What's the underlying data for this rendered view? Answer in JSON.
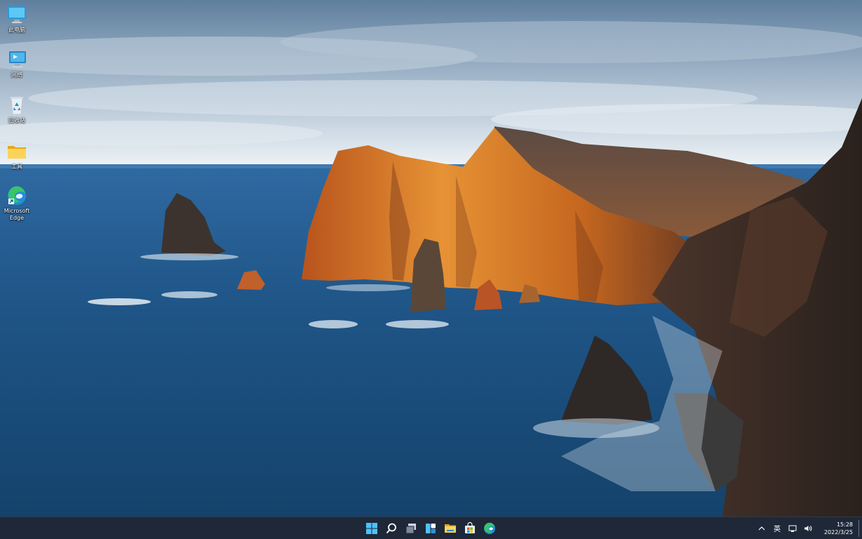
{
  "desktop": {
    "wallpaper": "coastal-cliffs-sea-wallpaper",
    "icons": [
      {
        "label": "此电脑",
        "icon": "this-pc-icon"
      },
      {
        "label": "网络",
        "icon": "network-icon"
      },
      {
        "label": "回收站",
        "icon": "recycle-bin-icon"
      },
      {
        "label": "工具",
        "icon": "folder-icon"
      },
      {
        "label": "Microsoft\nEdge",
        "icon": "edge-icon"
      }
    ]
  },
  "taskbar": {
    "background": "#1e2838",
    "apps": [
      {
        "name": "start",
        "icon": "windows-start-icon"
      },
      {
        "name": "search",
        "icon": "search-icon"
      },
      {
        "name": "task-view",
        "icon": "task-view-icon"
      },
      {
        "name": "widgets",
        "icon": "widgets-icon"
      },
      {
        "name": "file-explorer",
        "icon": "file-explorer-icon"
      },
      {
        "name": "microsoft-store",
        "icon": "store-icon"
      },
      {
        "name": "edge",
        "icon": "edge-icon"
      }
    ],
    "tray": {
      "ime_label": "英",
      "time": "15:28",
      "date": "2022/3/25"
    }
  },
  "colors": {
    "sky": "#7c9ab8",
    "sea": "#1f5a8a",
    "cliff_lit": "#d9832c",
    "cliff_dark": "#3a2c26",
    "accent_blue": "#3b8ee8"
  }
}
